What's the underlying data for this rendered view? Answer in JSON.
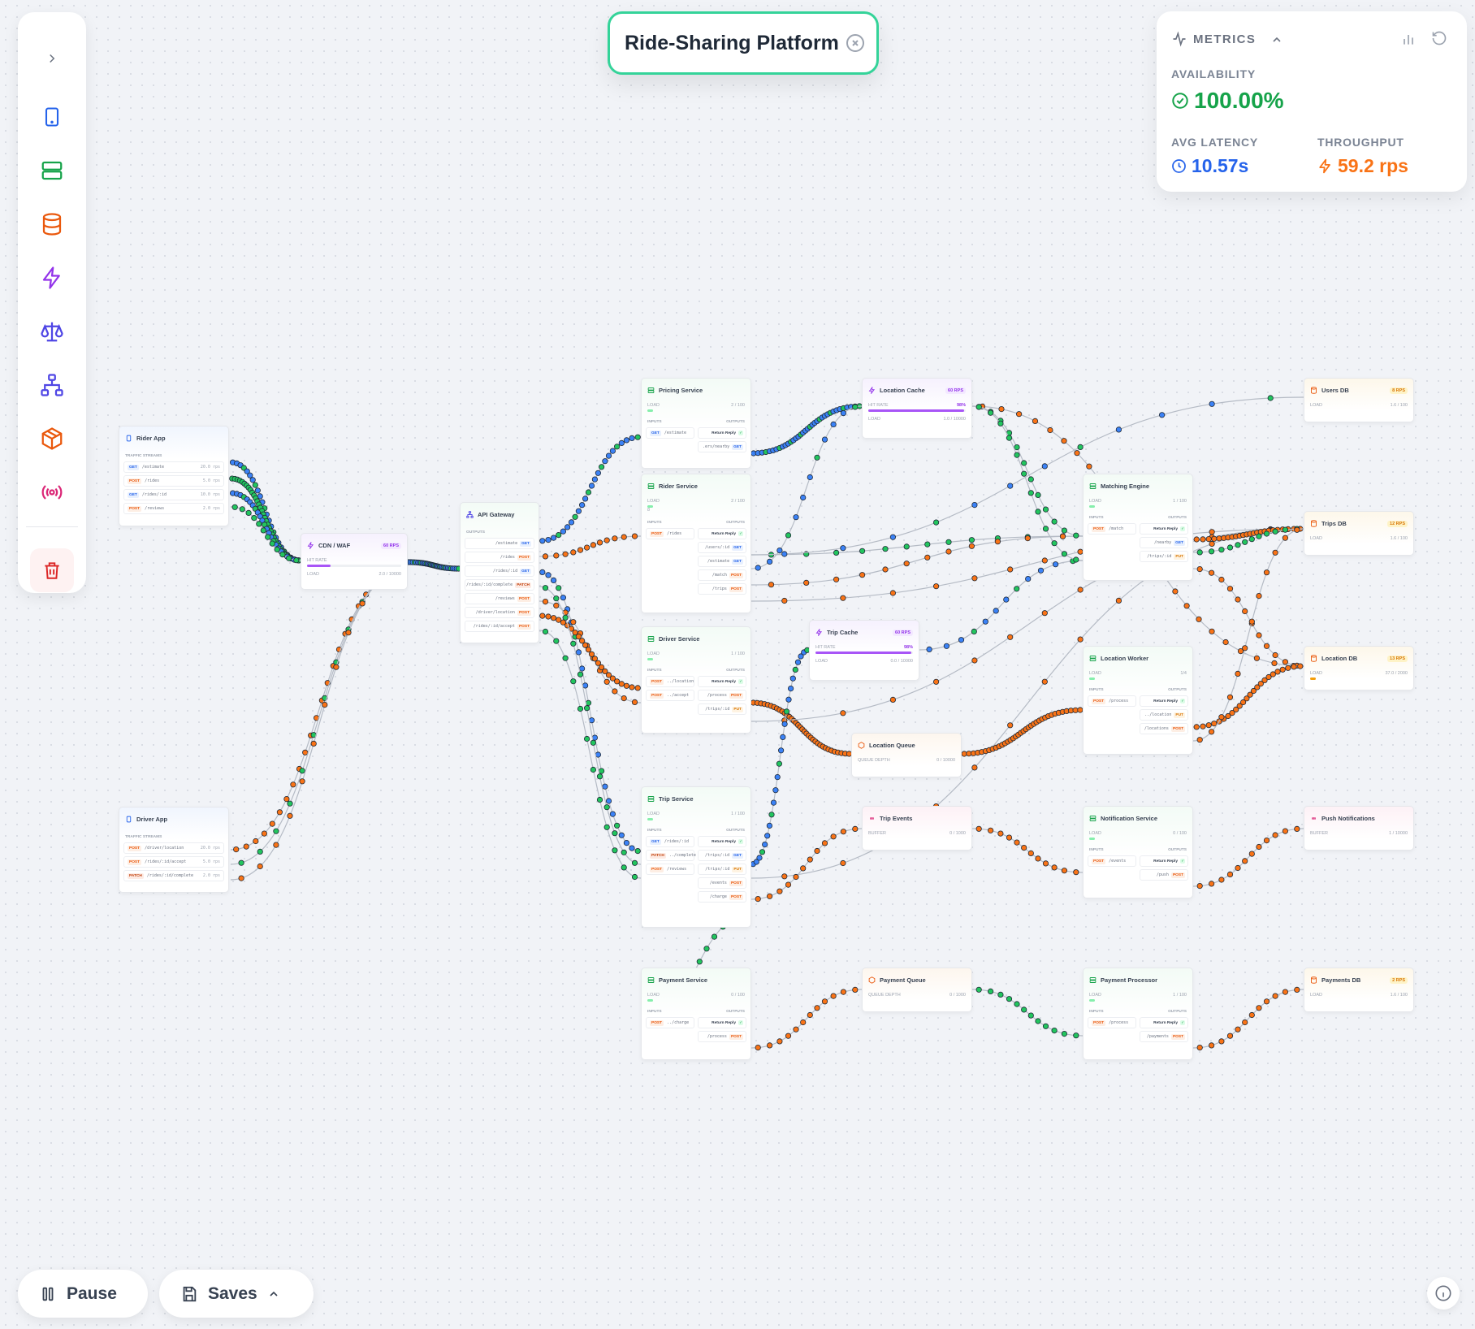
{
  "app": {
    "title": "Ride-Sharing Platform",
    "close_icon": "circle-x-icon"
  },
  "toolbar": {
    "expand_icon": "chevron-right-icon",
    "tools": [
      {
        "name": "client-tool",
        "icon": "tablet-icon",
        "color": "#2563eb"
      },
      {
        "name": "service-tool",
        "icon": "server-icon",
        "color": "#16a34a"
      },
      {
        "name": "database-tool",
        "icon": "database-icon",
        "color": "#ea580c"
      },
      {
        "name": "cache-tool",
        "icon": "bolt-icon",
        "color": "#9333ea"
      },
      {
        "name": "load-balancer-tool",
        "icon": "scale-icon",
        "color": "#4f46e5"
      },
      {
        "name": "gateway-tool",
        "icon": "network-icon",
        "color": "#4f46e5"
      },
      {
        "name": "queue-tool",
        "icon": "box-icon",
        "color": "#ea580c"
      },
      {
        "name": "events-tool",
        "icon": "broadcast-icon",
        "color": "#db2777"
      }
    ],
    "delete_icon": "trash-icon"
  },
  "metrics": {
    "header": "METRICS",
    "availability_label": "AVAILABILITY",
    "availability": "100.00%",
    "latency_label": "AVG LATENCY",
    "latency": "10.57s",
    "throughput_label": "THROUGHPUT",
    "throughput": "59.2 rps",
    "colors": {
      "availability": "#16a34a",
      "latency": "#2563eb",
      "throughput": "#f97316"
    }
  },
  "controls": {
    "pause_label": "Pause",
    "saves_label": "Saves"
  },
  "nodes": {
    "rider_app": {
      "title": "Rider App",
      "section": "TRAFFIC STREAMS",
      "streams": [
        {
          "method": "GET",
          "path": "/estimate",
          "rate": "20.0 rps"
        },
        {
          "method": "POST",
          "path": "/rides",
          "rate": "5.0 rps"
        },
        {
          "method": "GET",
          "path": "/rides/:id",
          "rate": "10.0 rps"
        },
        {
          "method": "POST",
          "path": "/reviews",
          "rate": "2.0 rps"
        }
      ]
    },
    "driver_app": {
      "title": "Driver App",
      "section": "TRAFFIC STREAMS",
      "streams": [
        {
          "method": "POST",
          "path": "/driver/location",
          "rate": "20.0 rps"
        },
        {
          "method": "POST",
          "path": "/rides/:id/accept",
          "rate": "5.0 rps"
        },
        {
          "method": "PATCH",
          "path": "/rides/:id/complete",
          "rate": "2.0 rps"
        }
      ]
    },
    "cdn": {
      "title": "CDN / WAF",
      "badge": "60 RPS",
      "hit_label": "HIT RATE",
      "load_label": "LOAD",
      "load": "2.0 / 10000",
      "hit": 0.25
    },
    "gateway": {
      "title": "API Gateway",
      "section": "OUTPUTS",
      "outputs": [
        {
          "path": "/estimate",
          "method": "GET"
        },
        {
          "path": "/rides",
          "method": "POST"
        },
        {
          "path": "/rides/:id",
          "method": "GET"
        },
        {
          "path": "/rides/:id/complete",
          "method": "PATCH"
        },
        {
          "path": "/reviews",
          "method": "POST"
        },
        {
          "path": "/driver/location",
          "method": "POST"
        },
        {
          "path": "/rides/:id/accept",
          "method": "POST"
        }
      ]
    },
    "pricing": {
      "title": "Pricing Service",
      "load_label": "LOAD",
      "load": "2 / 100",
      "inputs_label": "INPUTS",
      "outputs_label": "OUTPUTS",
      "inputs": [
        {
          "method": "GET",
          "path": "/estimate"
        }
      ],
      "outputs": [
        {
          "path": "Return Reply",
          "reply": true
        },
        {
          "path": ".ers/nearby",
          "method": "GET"
        }
      ]
    },
    "rider_svc": {
      "title": "Rider Service",
      "load_label": "LOAD",
      "load": "2 / 100",
      "load_sub": "8",
      "inputs_label": "INPUTS",
      "outputs_label": "OUTPUTS",
      "inputs": [
        {
          "method": "POST",
          "path": "/rides"
        }
      ],
      "outputs": [
        {
          "path": "Return Reply",
          "reply": true
        },
        {
          "path": "/users/:id",
          "method": "GET"
        },
        {
          "path": "/estimate",
          "method": "GET"
        },
        {
          "path": "/match",
          "method": "POST"
        },
        {
          "path": "/trips",
          "method": "POST"
        }
      ]
    },
    "driver_svc": {
      "title": "Driver Service",
      "load_label": "LOAD",
      "load": "1 / 100",
      "inputs_label": "INPUTS",
      "outputs_label": "OUTPUTS",
      "inputs": [
        {
          "method": "POST",
          "path": "../location"
        },
        {
          "method": "POST",
          "path": "../accept"
        }
      ],
      "outputs": [
        {
          "path": "Return Reply",
          "reply": true
        },
        {
          "path": "/process",
          "method": "POST"
        },
        {
          "path": "/trips/:id",
          "method": "PUT"
        }
      ]
    },
    "trip_svc": {
      "title": "Trip Service",
      "load_label": "LOAD",
      "load": "1 / 100",
      "inputs_label": "INPUTS",
      "outputs_label": "OUTPUTS",
      "inputs": [
        {
          "method": "GET",
          "path": "/rides/:id"
        },
        {
          "method": "PATCH",
          "path": "../complete"
        },
        {
          "method": "POST",
          "path": "/reviews"
        }
      ],
      "outputs": [
        {
          "path": "Return Reply",
          "reply": true
        },
        {
          "path": "/trips/:id",
          "method": "GET"
        },
        {
          "path": "/trips/:id",
          "method": "PUT"
        },
        {
          "path": "/events",
          "method": "POST"
        },
        {
          "path": "/charge",
          "method": "POST"
        }
      ]
    },
    "payment_svc": {
      "title": "Payment Service",
      "load_label": "LOAD",
      "load": "0 / 100",
      "inputs_label": "INPUTS",
      "outputs_label": "OUTPUTS",
      "inputs": [
        {
          "method": "POST",
          "path": "../charge"
        }
      ],
      "outputs": [
        {
          "path": "Return Reply",
          "reply": true
        },
        {
          "path": "/process",
          "method": "POST"
        }
      ]
    },
    "loc_cache": {
      "title": "Location Cache",
      "badge": "60 RPS",
      "hit_label": "HIT RATE",
      "hit_text": "98%",
      "load_label": "LOAD",
      "load": "1.0 / 10000",
      "hit": 0.98
    },
    "trip_cache": {
      "title": "Trip Cache",
      "badge": "60 RPS",
      "hit_label": "HIT RATE",
      "hit_text": "98%",
      "load_label": "LOAD",
      "load": "0.0 / 10000",
      "hit": 0.98
    },
    "loc_queue": {
      "title": "Location Queue",
      "depth_label": "QUEUE DEPTH",
      "depth": "0 / 10000"
    },
    "pay_queue": {
      "title": "Payment Queue",
      "depth_label": "QUEUE DEPTH",
      "depth": "0 / 1000"
    },
    "trip_events": {
      "title": "Trip Events",
      "buffer_label": "BUFFER",
      "buffer": "0 / 1000"
    },
    "push": {
      "title": "Push Notifications",
      "buffer_label": "BUFFER",
      "buffer": "1 / 10000"
    },
    "matching": {
      "title": "Matching Engine",
      "load_label": "LOAD",
      "load": "1 / 100",
      "inputs_label": "INPUTS",
      "outputs_label": "OUTPUTS",
      "inputs": [
        {
          "method": "POST",
          "path": "/match"
        }
      ],
      "outputs": [
        {
          "path": "Return Reply",
          "reply": true
        },
        {
          "path": "/nearby",
          "method": "GET"
        },
        {
          "path": "/trips/:id",
          "method": "PUT"
        }
      ]
    },
    "loc_worker": {
      "title": "Location Worker",
      "load_label": "LOAD",
      "load": "1/4",
      "inputs_label": "INPUTS",
      "outputs_label": "OUTPUTS",
      "inputs": [
        {
          "method": "POST",
          "path": "/process"
        }
      ],
      "outputs": [
        {
          "path": "Return Reply",
          "reply": true
        },
        {
          "path": "../location",
          "method": "PUT"
        },
        {
          "path": "/locations",
          "method": "POST"
        }
      ]
    },
    "notif": {
      "title": "Notification Service",
      "load_label": "LOAD",
      "load": "0 / 100",
      "inputs_label": "INPUTS",
      "outputs_label": "OUTPUTS",
      "inputs": [
        {
          "method": "POST",
          "path": "/events"
        }
      ],
      "outputs": [
        {
          "path": "Return Reply",
          "reply": true
        },
        {
          "path": "/push",
          "method": "POST"
        }
      ]
    },
    "pay_proc": {
      "title": "Payment Processor",
      "load_label": "LOAD",
      "load": "1 / 100",
      "inputs_label": "INPUTS",
      "outputs_label": "OUTPUTS",
      "inputs": [
        {
          "method": "POST",
          "path": "/process"
        }
      ],
      "outputs": [
        {
          "path": "Return Reply",
          "reply": true
        },
        {
          "path": "/payments",
          "method": "POST"
        }
      ]
    },
    "users_db": {
      "title": "Users DB",
      "badge": "8 RPS",
      "load_label": "LOAD",
      "load": "1.6 / 100"
    },
    "trips_db": {
      "title": "Trips DB",
      "badge": "12 RPS",
      "load_label": "LOAD",
      "load": "1.6 / 100"
    },
    "location_db": {
      "title": "Location DB",
      "badge": "13 RPS",
      "load_label": "LOAD",
      "load": "37.0 / 2000"
    },
    "payments_db": {
      "title": "Payments DB",
      "badge": "2 RPS",
      "load_label": "LOAD",
      "load": "1.6 / 100"
    }
  }
}
